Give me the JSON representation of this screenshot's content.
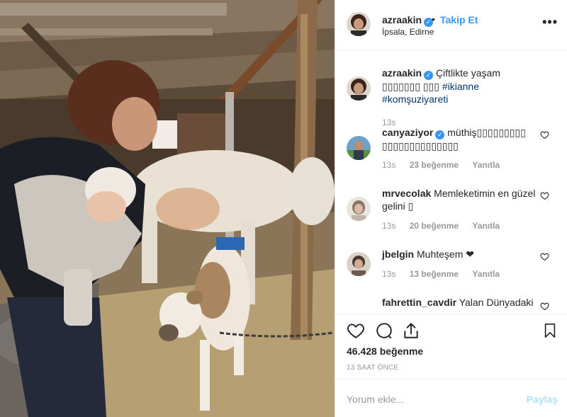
{
  "post": {
    "username": "azraakin",
    "follow_label": "Takip Et",
    "location": "İpsala, Edirne",
    "more_icon": "more-options-icon",
    "separator": "•"
  },
  "comments": [
    {
      "username": "azraakin",
      "verified": true,
      "text": "Çiftlikte yaşam ▯▯▯▯▯▯▯ ▯▯▯",
      "hashtags": "#ikianne #komşuziyareti",
      "time": "13s"
    },
    {
      "username": "canyaziyor",
      "verified": true,
      "text": "müthiş▯▯▯▯▯▯▯▯▯ ▯▯▯▯▯▯▯▯▯▯▯▯▯▯",
      "time": "13s",
      "likes": "23 beğenme",
      "reply": "Yanıtla"
    },
    {
      "username": "mrvecolak",
      "text": "Memleketimin en güzel gelini ▯",
      "time": "13s",
      "likes": "20 beğenme",
      "reply": "Yanıtla"
    },
    {
      "username": "jbelgin",
      "text": "Muhteşem ❤",
      "time": "13s",
      "likes": "13 beğenme",
      "reply": "Yanıtla"
    },
    {
      "username": "fahrettin_cavdir",
      "text": "Yalan Dünyadaki"
    }
  ],
  "actions": {
    "likes": "46.428 beğenme",
    "time_ago": "13 SAAT ÖNCE"
  },
  "add_comment": {
    "placeholder": "Yorum ekle...",
    "share_label": "Paylaş"
  },
  "colors": {
    "link_blue": "#3897f0",
    "share_disabled": "#b2dffc",
    "muted": "#999999",
    "text": "#262626",
    "border": "#efefef"
  }
}
